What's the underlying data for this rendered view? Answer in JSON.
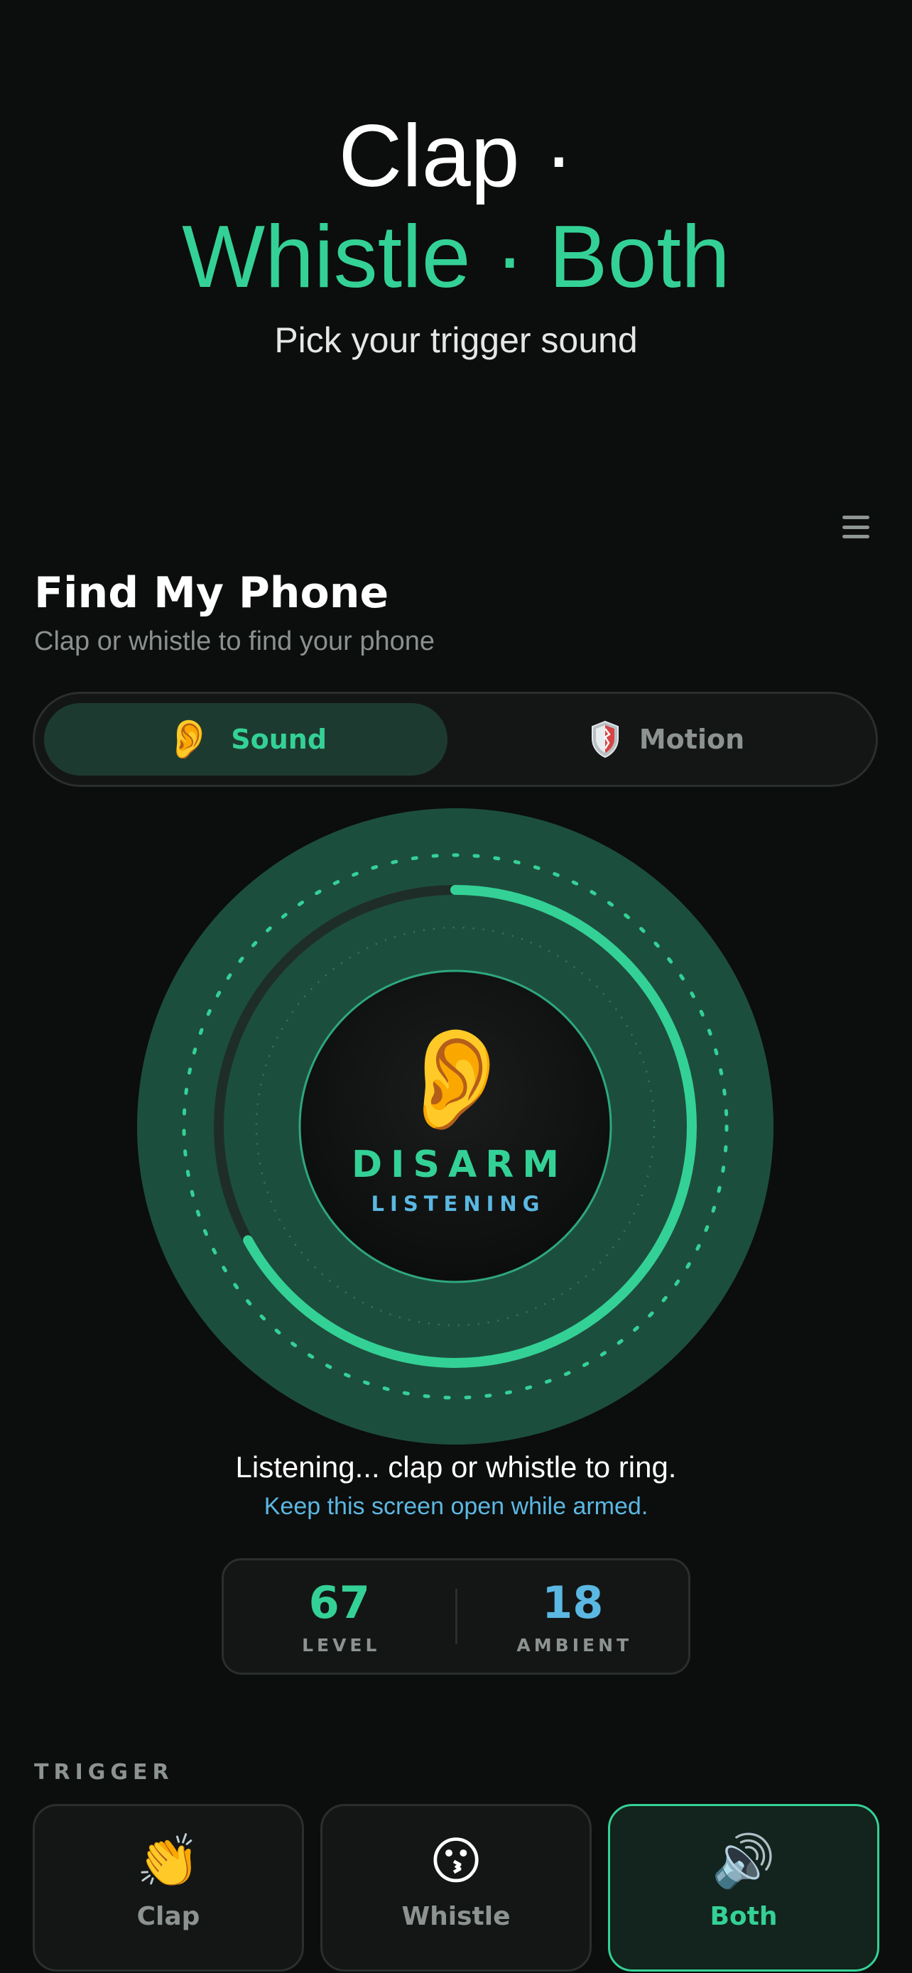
{
  "hero": {
    "line1": "Clap ·",
    "line2": "Whistle · Both",
    "subtitle": "Pick your trigger sound"
  },
  "header": {
    "title": "Find My Phone",
    "subtitle": "Clap or whistle to find your phone",
    "menu_icon": "hamburger-menu-icon"
  },
  "mode_tabs": [
    {
      "label": "Sound",
      "icon": "ear-icon",
      "emoji": "👂",
      "selected": true
    },
    {
      "label": "Motion",
      "icon": "shield-icon",
      "selected": false
    }
  ],
  "dial": {
    "icon": "ear-icon",
    "emoji": "👂",
    "action_label": "DISARM",
    "state_label": "LISTENING",
    "level_fraction": 0.67
  },
  "status": {
    "message": "Listening... clap or whistle to ring.",
    "hint": "Keep this screen open while armed."
  },
  "stats": {
    "level": {
      "value": "67",
      "label": "LEVEL",
      "color": "#34d196"
    },
    "ambient": {
      "value": "18",
      "label": "AMBIENT",
      "color": "#5bb8e2"
    }
  },
  "trigger": {
    "section_label": "TRIGGER",
    "options": [
      {
        "label": "Clap",
        "icon": "clapping-hands-icon",
        "emoji": "👏",
        "selected": false
      },
      {
        "label": "Whistle",
        "icon": "kissing-face-icon",
        "emoji": "😗",
        "selected": false
      },
      {
        "label": "Both",
        "icon": "speaker-icon",
        "emoji": "🔊",
        "selected": true
      }
    ]
  },
  "colors": {
    "accent": "#34d196",
    "info": "#5bb8e2",
    "background": "#0c0d0d",
    "ring": "#1c4e3e"
  }
}
